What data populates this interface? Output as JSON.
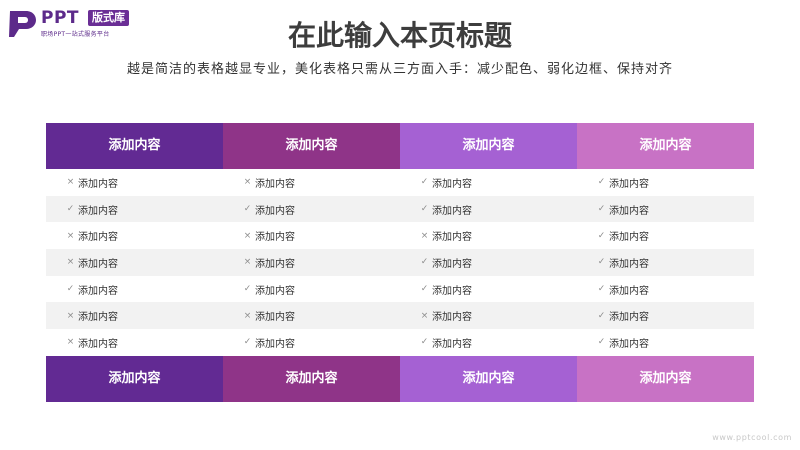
{
  "logo": {
    "name": "PPT",
    "badge": "版式库",
    "slogan": "职场PPT一站式服务平台"
  },
  "title": "在此输入本页标题",
  "subtitle": "越是简洁的表格越显专业，美化表格只需从三方面入手：减少配色、弱化边框、保持对齐",
  "table": {
    "headers": [
      "添加内容",
      "添加内容",
      "添加内容",
      "添加内容"
    ],
    "rows": [
      {
        "cells": [
          {
            "mark": "×",
            "text": "添加内容"
          },
          {
            "mark": "×",
            "text": "添加内容"
          },
          {
            "mark": "✓",
            "text": "添加内容"
          },
          {
            "mark": "✓",
            "text": "添加内容"
          }
        ]
      },
      {
        "cells": [
          {
            "mark": "✓",
            "text": "添加内容"
          },
          {
            "mark": "✓",
            "text": "添加内容"
          },
          {
            "mark": "✓",
            "text": "添加内容"
          },
          {
            "mark": "✓",
            "text": "添加内容"
          }
        ]
      },
      {
        "cells": [
          {
            "mark": "×",
            "text": "添加内容"
          },
          {
            "mark": "×",
            "text": "添加内容"
          },
          {
            "mark": "×",
            "text": "添加内容"
          },
          {
            "mark": "✓",
            "text": "添加内容"
          }
        ]
      },
      {
        "cells": [
          {
            "mark": "×",
            "text": "添加内容"
          },
          {
            "mark": "×",
            "text": "添加内容"
          },
          {
            "mark": "✓",
            "text": "添加内容"
          },
          {
            "mark": "✓",
            "text": "添加内容"
          }
        ]
      },
      {
        "cells": [
          {
            "mark": "✓",
            "text": "添加内容"
          },
          {
            "mark": "✓",
            "text": "添加内容"
          },
          {
            "mark": "✓",
            "text": "添加内容"
          },
          {
            "mark": "✓",
            "text": "添加内容"
          }
        ]
      },
      {
        "cells": [
          {
            "mark": "×",
            "text": "添加内容"
          },
          {
            "mark": "×",
            "text": "添加内容"
          },
          {
            "mark": "×",
            "text": "添加内容"
          },
          {
            "mark": "✓",
            "text": "添加内容"
          }
        ]
      },
      {
        "cells": [
          {
            "mark": "×",
            "text": "添加内容"
          },
          {
            "mark": "✓",
            "text": "添加内容"
          },
          {
            "mark": "✓",
            "text": "添加内容"
          },
          {
            "mark": "✓",
            "text": "添加内容"
          }
        ]
      }
    ],
    "footers": [
      "添加内容",
      "添加内容",
      "添加内容",
      "添加内容"
    ],
    "column_colors": [
      "#622a93",
      "#8f3488",
      "#a561d3",
      "#c872c5"
    ]
  },
  "watermark": "www.pptcool.com"
}
